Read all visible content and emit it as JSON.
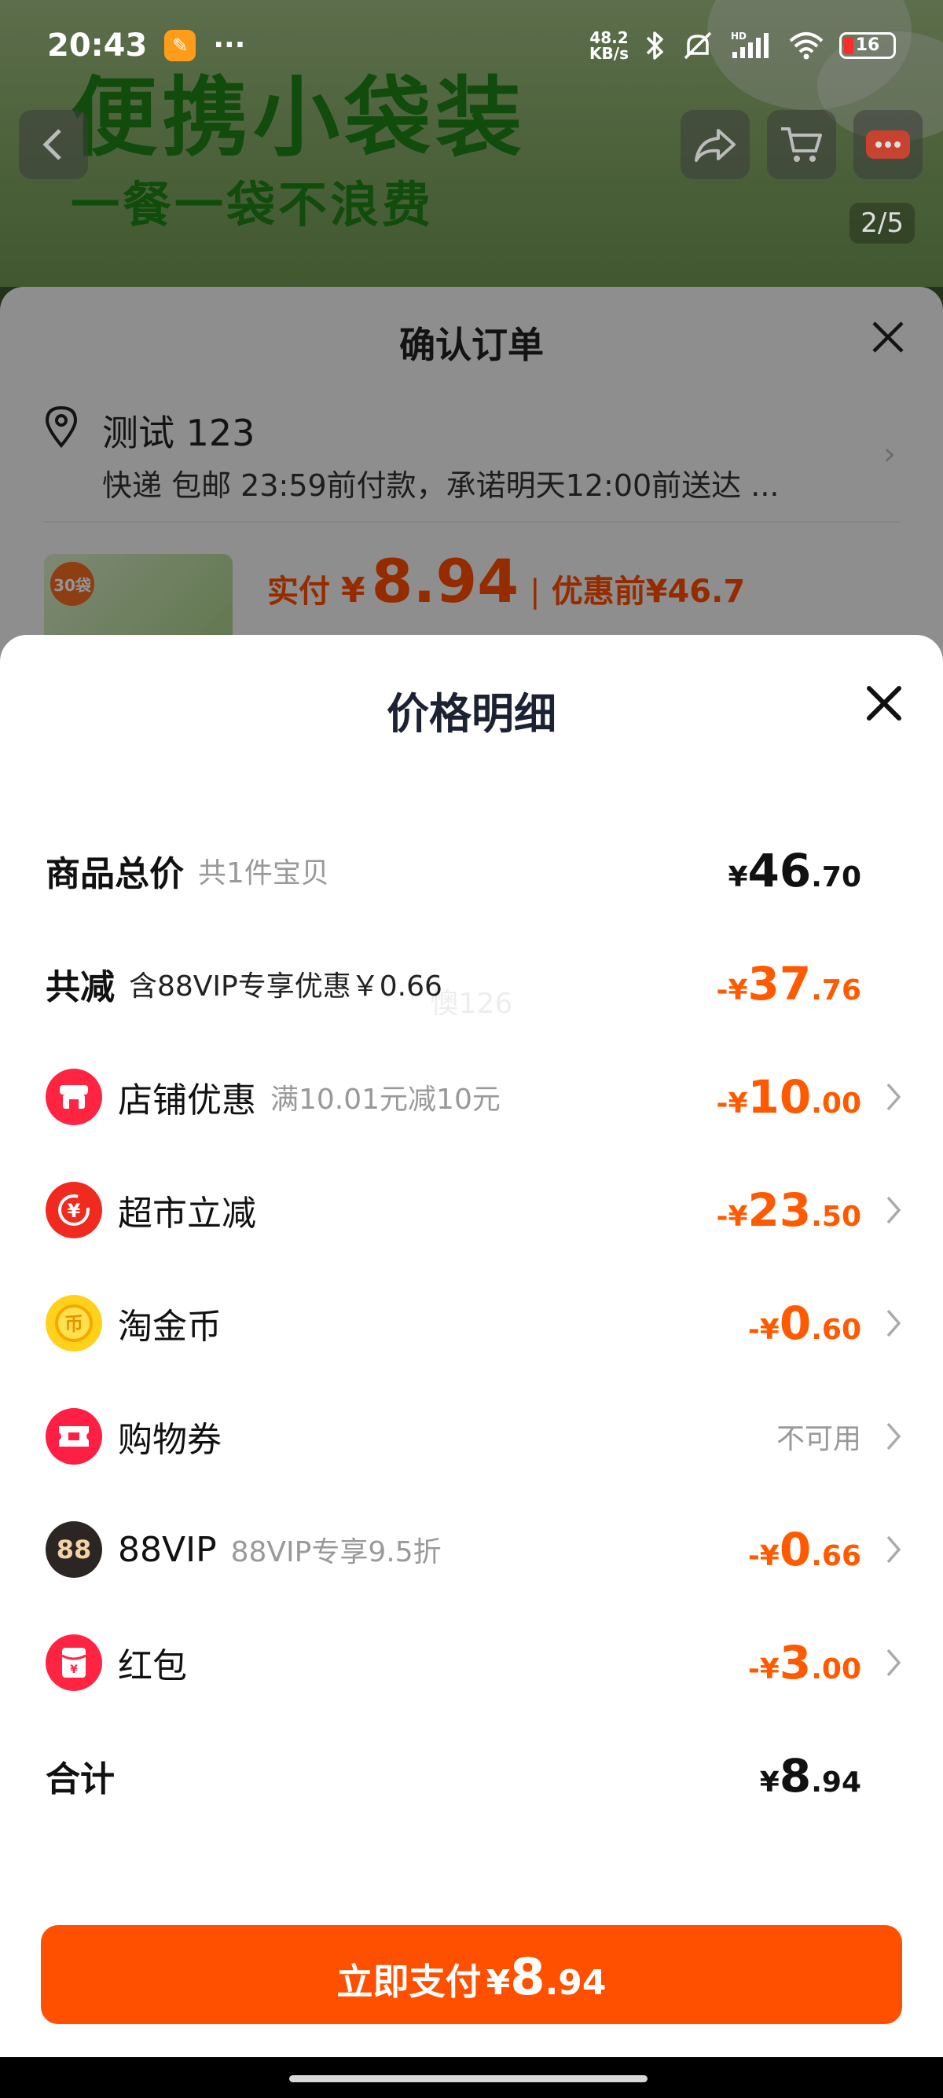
{
  "status_bar": {
    "time": "20:43",
    "net_speed_value": "48.2",
    "net_speed_unit": "KB/s",
    "battery": "16",
    "icons": [
      "app-notification-icon",
      "more-dots-icon",
      "bluetooth-icon",
      "mute-icon",
      "hd-signal-icon",
      "wifi-icon",
      "battery-icon"
    ]
  },
  "banner": {
    "headline": "便携小袋装",
    "sub": "一餐一袋不浪费",
    "image_counter": "2/5"
  },
  "order_sheet": {
    "title": "确认订单",
    "address_name": "测试 123",
    "delivery": "快递 包邮 23:59前付款，承诺明天12:00前送达 ...",
    "badge": "30袋",
    "actual_label": "实付",
    "actual_yen": "¥",
    "actual_value": "8.94",
    "before_label": "优惠前",
    "before_value": "¥46.7"
  },
  "price_detail": {
    "title": "价格明细",
    "watermark": "懊126",
    "total": {
      "label": "商品总价",
      "sub": "共1件宝贝",
      "prefix": "¥",
      "int": "46",
      "dec": ".70"
    },
    "reduce": {
      "label": "共减",
      "sub": "含88VIP专享优惠￥0.66",
      "prefix": "-¥",
      "int": "37",
      "dec": ".76"
    },
    "items": [
      {
        "label": "店铺优惠",
        "sub": "满10.01元减10元",
        "prefix": "-¥",
        "int": "10",
        "dec": ".00",
        "icon": "shop-icon",
        "color": "#ff2442"
      },
      {
        "label": "超市立减",
        "sub": "",
        "prefix": "-¥",
        "int": "23",
        "dec": ".50",
        "icon": "supermarket-yuan-icon",
        "color": "#f02a1f"
      },
      {
        "label": "淘金币",
        "sub": "",
        "prefix": "-¥",
        "int": "0",
        "dec": ".60",
        "icon": "gold-coin-icon",
        "color": "#ffd11a"
      },
      {
        "label": "购物券",
        "sub": "",
        "status": "不可用",
        "icon": "shopping-voucher-icon",
        "color": "#ff1f44"
      },
      {
        "label": "88VIP",
        "sub": "88VIP专享9.5折",
        "prefix": "-¥",
        "int": "0",
        "dec": ".66",
        "icon": "88vip-icon",
        "icon_text": "88",
        "color": "#2b2523"
      },
      {
        "label": "红包",
        "sub": "",
        "prefix": "-¥",
        "int": "3",
        "dec": ".00",
        "icon": "red-packet-icon",
        "color": "#ff2442"
      }
    ],
    "sum": {
      "label": "合计",
      "prefix": "¥",
      "int": "8",
      "dec": ".94"
    }
  },
  "pay_button": {
    "label": "立即支付",
    "prefix": "¥",
    "int": "8",
    "dec": ".94"
  },
  "colors": {
    "accent_orange": "#ff5000",
    "discount_orange": "#ff5a00",
    "title_dark": "#1c2233"
  }
}
